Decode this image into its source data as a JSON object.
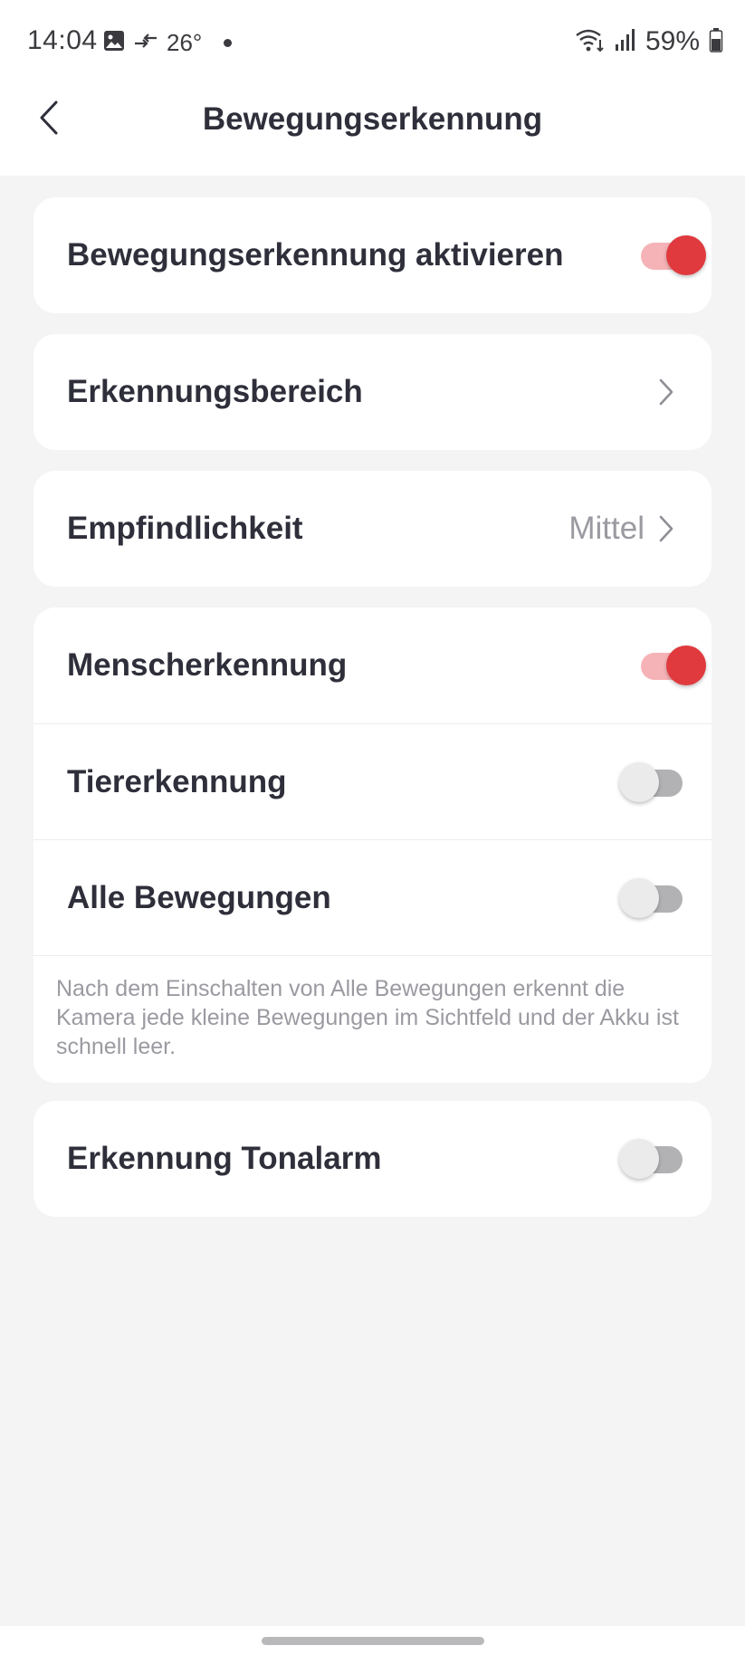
{
  "status_bar": {
    "time": "14:04",
    "temperature": "26°",
    "battery_percent": "59%",
    "icons": [
      "gallery-icon",
      "data-transfer-icon",
      "notification-dot-icon",
      "wifi-icon",
      "signal-icon",
      "battery-icon"
    ]
  },
  "header": {
    "title": "Bewegungserkennung",
    "back_icon": "chevron-left-icon"
  },
  "settings": {
    "activate_motion": {
      "label": "Bewegungserkennung aktivieren",
      "enabled": true
    },
    "detection_area": {
      "label": "Erkennungsbereich"
    },
    "sensitivity": {
      "label": "Empfindlichkeit",
      "value": "Mittel"
    },
    "human_detection": {
      "label": "Menscherkennung",
      "enabled": true
    },
    "animal_detection": {
      "label": "Tiererkennung",
      "enabled": false
    },
    "all_motion": {
      "label": "Alle Bewegungen",
      "enabled": false
    },
    "all_motion_note": "Nach dem Einschalten von Alle Bewegungen erkennt die Kamera jede kleine Bewegungen im Sichtfeld und der Akku ist schnell leer.",
    "tone_alarm": {
      "label": "Erkennung Tonalarm",
      "enabled": false
    }
  },
  "colors": {
    "accent": "#e03a3e",
    "accent_track": "#f6b3b7",
    "off_track": "#b2b2b5",
    "background": "#f4f4f5",
    "text_primary": "#2e2f3a",
    "text_secondary": "#9a9aa1"
  }
}
